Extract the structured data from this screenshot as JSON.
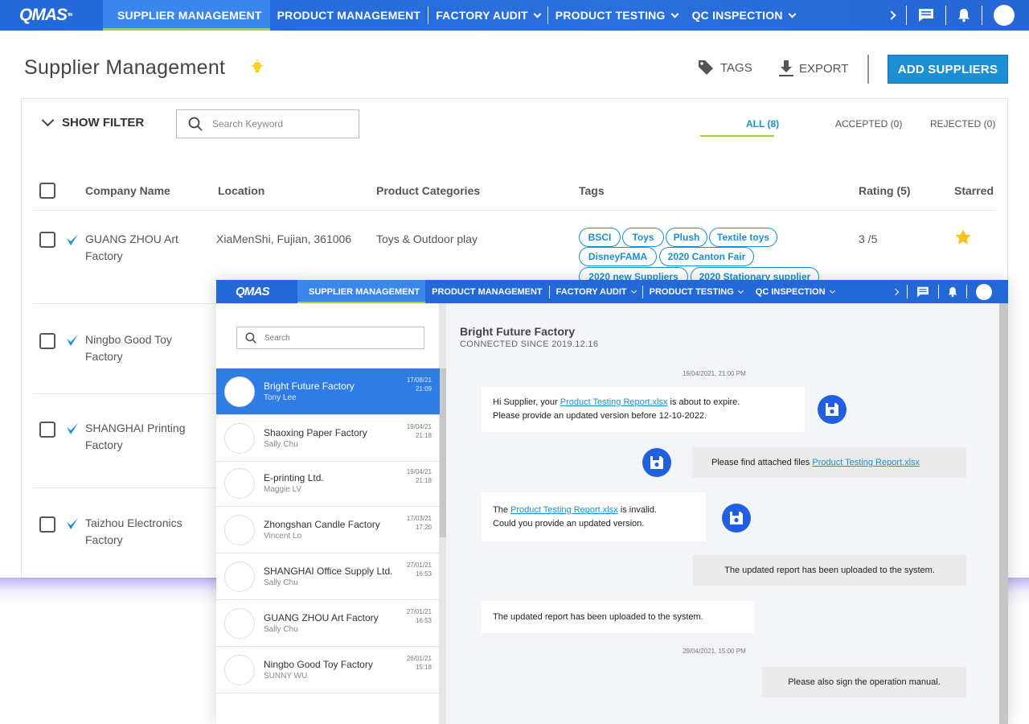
{
  "nav": {
    "logo": "QMAS",
    "logo_mark": "TM",
    "items": [
      {
        "label": "SUPPLIER MANAGEMENT"
      },
      {
        "label": "PRODUCT MANAGEMENT"
      },
      {
        "label": "FACTORY AUDIT"
      },
      {
        "label": "PRODUCT TESTING"
      },
      {
        "label": "QC INSPECTION"
      }
    ]
  },
  "header": {
    "title": "Supplier Management",
    "tags_label": "TAGS",
    "export_label": "EXPORT",
    "add_label": "ADD SUPPLIERS"
  },
  "filter": {
    "show_label": "SHOW FILTER",
    "search_placeholder": "Search Keyword",
    "tabs": [
      {
        "label": "ALL (8)"
      },
      {
        "label": "ACCEPTED (0)"
      },
      {
        "label": "REJECTED (0)"
      }
    ]
  },
  "table": {
    "columns": [
      "Company Name",
      "Location",
      "Product Categories",
      "Tags",
      "Rating (5)",
      "Starred"
    ],
    "rows": [
      {
        "company": "GUANG ZHOU Art Factory",
        "location": "XiaMenShi, Fujian, 361006",
        "categories": "Toys & Outdoor play",
        "tags": [
          "BSCI",
          "Toys",
          "Plush",
          "Textile toys",
          "DisneyFAMA",
          "2020 Canton Fair",
          "2020 new Suppliers",
          "2020 Stationary supplier"
        ],
        "rating": "3 /5"
      },
      {
        "company": "Ningbo Good Toy Factory"
      },
      {
        "company": "SHANGHAI Printing Factory"
      },
      {
        "company": "Taizhou Electronics Factory"
      }
    ]
  },
  "overlay": {
    "search_placeholder": "Search",
    "conversations": [
      {
        "name": "Bright Future Factory",
        "person": "Tony Lee",
        "date": "17/08/21",
        "time": "21:09"
      },
      {
        "name": "Shaoxing Paper Factory",
        "person": "Sally Chu",
        "date": "19/04/21",
        "time": "21:18"
      },
      {
        "name": "E-printing Ltd.",
        "person": "Maggie LV",
        "date": "19/04/21",
        "time": "21:18"
      },
      {
        "name": "Zhongshan Candle Factory",
        "person": "Vincent Lo",
        "date": "17/03/21",
        "time": "17:20"
      },
      {
        "name": "SHANGHAI Office Supply Ltd.",
        "person": "Sally Chu",
        "date": "27/01/21",
        "time": "16:53"
      },
      {
        "name": "GUANG ZHOU Art Factory",
        "person": "Sally Chu",
        "date": "27/01/21",
        "time": "16:53"
      },
      {
        "name": "Ningbo Good Toy Factory",
        "person": "SUNNY WU",
        "date": "26/01/21",
        "time": "15:18"
      }
    ],
    "chat": {
      "title": "Bright Future Factory",
      "subtitle": "CONNECTED SINCE 2019.12.16",
      "stamp1": "19/04/2021, 21:00 PM",
      "stamp2": "29/04/2021, 15:00 PM",
      "m1_pre": "Hi Supplier, your ",
      "m1_link": "Product Testing Report.xlsx",
      "m1_post": " is about to expire.",
      "m1_line2": "Please provide an updated version before 12-10-2022.",
      "m2_pre": "Please find attached files ",
      "m2_link": "Product Testing Report.xlsx",
      "m3_pre": "The ",
      "m3_link": "Product Testing Report.xlsx",
      "m3_post": " is invalid.",
      "m3_line2": "Could you provide an updated version.",
      "m4": "The updated report has been uploaded to the system.",
      "m5": "The updated report has been uploaded to the system.",
      "m6": "Please also sign the operation manual."
    }
  },
  "colors": {
    "nav_blue": "#2468d8",
    "accent_green": "#a3d22e",
    "primary_blue": "#1b8fd3",
    "star_yellow": "#f7c21b"
  }
}
